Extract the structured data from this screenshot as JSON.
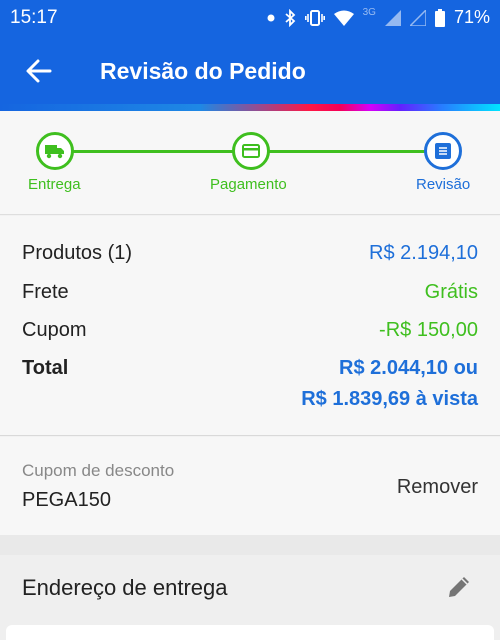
{
  "status_bar": {
    "time": "15:17",
    "network": "3G",
    "battery": "71%"
  },
  "app_bar": {
    "title": "Revisão do Pedido"
  },
  "stepper": {
    "steps": [
      {
        "label": "Entrega",
        "icon": "truck-icon",
        "state": "done"
      },
      {
        "label": "Pagamento",
        "icon": "credit-card-icon",
        "state": "done"
      },
      {
        "label": "Revisão",
        "icon": "list-icon",
        "state": "active"
      }
    ]
  },
  "summary": {
    "products_label": "Produtos (1)",
    "products_value": "R$ 2.194,10",
    "shipping_label": "Frete",
    "shipping_value": "Grátis",
    "coupon_label": "Cupom",
    "coupon_value": "-R$ 150,00",
    "total_label": "Total",
    "total_value_line1": "R$ 2.044,10 ou",
    "total_value_line2": "R$ 1.839,69 à vista"
  },
  "coupon": {
    "caption": "Cupom de desconto",
    "code": "PEGA150",
    "remove_label": "Remover"
  },
  "address": {
    "heading": "Endereço de entrega"
  },
  "colors": {
    "primary": "#1565e0",
    "accent_blue": "#1e6fd9",
    "success_green": "#3fbf1f"
  }
}
